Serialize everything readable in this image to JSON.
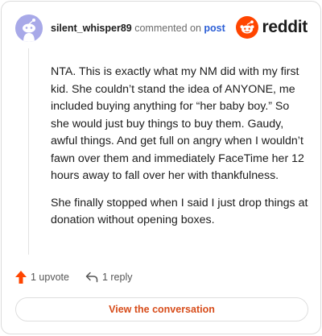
{
  "comment": {
    "username": "silent_whisper89",
    "action_text": "commented on",
    "post_link_text": "post",
    "paragraphs": [
      "NTA. This is exactly what my NM did with my first kid. She couldn’t stand the idea of ANYONE, me included buying anything for “her baby boy.” So she would just buy things to buy them. Gaudy, awful things. And get full on angry when I wouldn’t fawn over them and immediately FaceTime her 12 hours away to fall over her with thankfulness.",
      "She finally stopped when I said I just drop things at donation without opening boxes."
    ]
  },
  "brand": {
    "name": "reddit",
    "accent": "#ff4500"
  },
  "actions": {
    "upvote_label": "1 upvote",
    "reply_label": "1 reply"
  },
  "view_button_label": "View the conversation",
  "icons": {
    "avatar": "snoo-avatar-icon",
    "brand": "reddit-logo-icon",
    "upvote": "upvote-arrow-icon",
    "reply": "reply-arrow-icon"
  }
}
